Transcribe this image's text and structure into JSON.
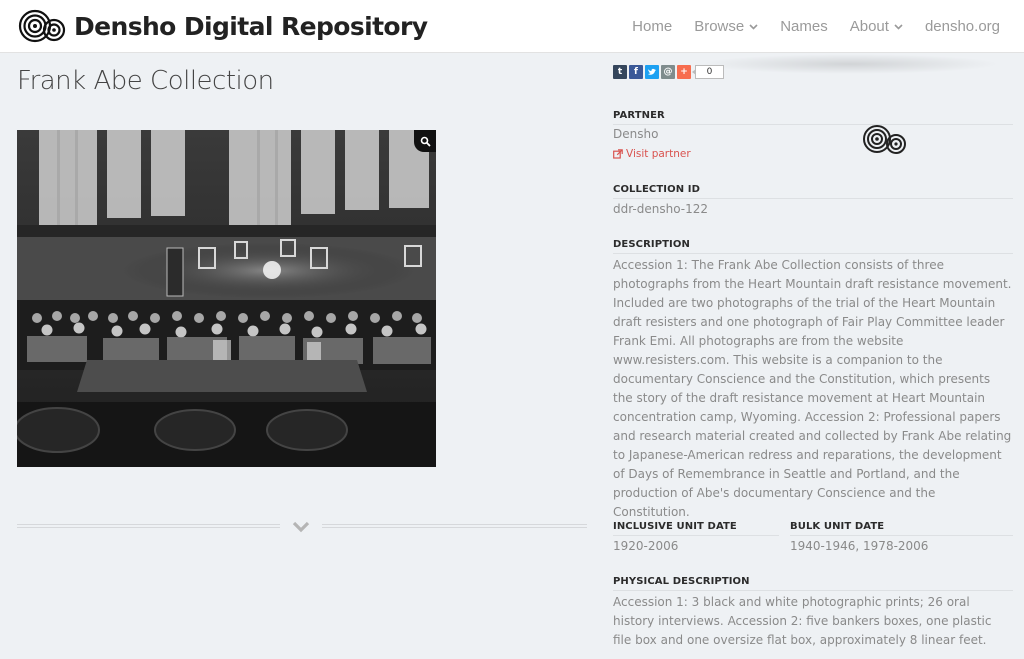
{
  "brand": {
    "name": "Densho Digital Repository"
  },
  "nav": {
    "home": "Home",
    "browse": "Browse",
    "names": "Names",
    "about": "About",
    "densho_org": "densho.org"
  },
  "page": {
    "title": "Frank Abe Collection"
  },
  "share": {
    "tumblr": "t",
    "facebook": "f",
    "twitter": "t",
    "email": "@",
    "plus": "+",
    "count": "0"
  },
  "partner": {
    "label": "PARTNER",
    "name": "Densho",
    "visit_label": "Visit partner"
  },
  "collection_id": {
    "label": "COLLECTION ID",
    "value": "ddr-densho-122"
  },
  "description": {
    "label": "DESCRIPTION",
    "text": "Accession 1: The Frank Abe Collection consists of three photographs from the Heart Mountain draft resistance movement. Included are two photographs of the trial of the Heart Mountain draft resisters and one photograph of Fair Play Committee leader Frank Emi. All photographs are from the website www.resisters.com. This website is a companion to the documentary Conscience and the Constitution, which presents the story of the draft resistance movement at Heart Mountain concentration camp, Wyoming. Accession 2: Professional papers and research material created and collected by Frank Abe relating to Japanese-American redress and reparations, the development of Days of Remembrance in Seattle and Portland, and the production of Abe's documentary Conscience and the Constitution."
  },
  "inclusive_date": {
    "label": "INCLUSIVE UNIT DATE",
    "value": "1920-2006"
  },
  "bulk_date": {
    "label": "BULK UNIT DATE",
    "value": "1940-1946, 1978-2006"
  },
  "physical": {
    "label": "PHYSICAL DESCRIPTION",
    "text": "Accession 1: 3 black and white photographic prints; 26 oral history interviews. Accession 2: five bankers boxes, one plastic file box and one oversize flat box, approximately 8 linear feet."
  },
  "colors": {
    "accent_red": "#d9534f",
    "tumblr": "#35465c",
    "facebook": "#3b5998",
    "twitter": "#1da1f2",
    "email": "#7f8c8d",
    "plus": "#f76d4f"
  }
}
